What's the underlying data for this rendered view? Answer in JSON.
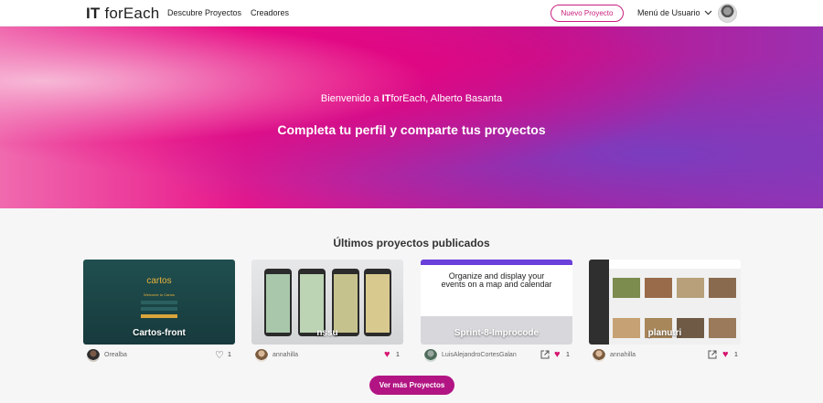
{
  "nav": {
    "logo_bold": "IT",
    "logo_rest": " forEach",
    "links": [
      "Descubre Proyectos",
      "Creadores"
    ],
    "new_project": "Nuevo Proyecto",
    "user_menu": "Menú de Usuario"
  },
  "hero": {
    "welcome_prefix": "Bienvenido a ",
    "welcome_brand_bold": "IT",
    "welcome_brand_rest": "forEach, Alberto Basanta",
    "title": "Completa tu perfil y comparte tus proyectos"
  },
  "section": {
    "title": "Últimos proyectos publicados"
  },
  "projects": [
    {
      "name": "Cartos-front",
      "author": "Orealba",
      "likes": "1",
      "liked": false,
      "external": false,
      "thumb_text": "cartos",
      "thumb_sub": "Welcome to Cartos"
    },
    {
      "name": "nssu",
      "author": "annahilla",
      "likes": "1",
      "liked": true,
      "external": false
    },
    {
      "name": "Sprint-8-Improcode",
      "author": "LuisAlejandroCortesGalan",
      "likes": "1",
      "liked": true,
      "external": true,
      "thumb_text": "Organize and display your events on a map and calendar"
    },
    {
      "name": "planutri",
      "author": "annahilla",
      "likes": "1",
      "liked": true,
      "external": true
    }
  ],
  "more_button": "Ver más Proyectos",
  "colors": {
    "accent": "#c81f7c",
    "heart": "#d6156f"
  }
}
